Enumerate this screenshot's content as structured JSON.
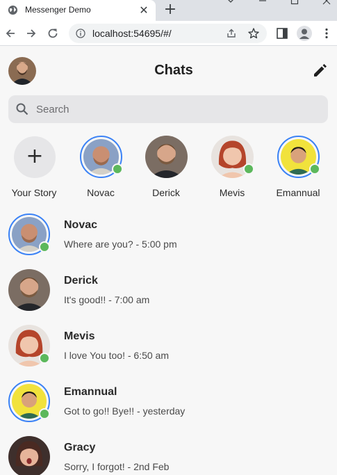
{
  "browser": {
    "tab_title": "Messenger Demo",
    "tab_close": "✕",
    "new_tab": "+",
    "url": "localhost:54695/#/"
  },
  "app": {
    "title": "Chats",
    "search_placeholder": "Search",
    "add_story_label": "+",
    "your_story_label": "Your Story"
  },
  "stories": [
    {
      "name": "Novac",
      "active": true,
      "online": true
    },
    {
      "name": "Derick",
      "active": false,
      "online": false
    },
    {
      "name": "Mevis",
      "active": false,
      "online": true
    },
    {
      "name": "Emannual",
      "active": true,
      "online": true
    }
  ],
  "chats": [
    {
      "name": "Novac",
      "message": "Where are you? - 5:00 pm",
      "active": true,
      "online": true
    },
    {
      "name": "Derick",
      "message": "It's good!! - 7:00 am",
      "active": false,
      "online": false
    },
    {
      "name": "Mevis",
      "message": "I love You too! - 6:50 am",
      "active": false,
      "online": true
    },
    {
      "name": "Emannual",
      "message": "Got to go!! Bye!! - yesterday",
      "active": true,
      "online": true
    },
    {
      "name": "Gracy",
      "message": "Sorry, I forgot! - 2nd Feb",
      "active": false,
      "online": false
    }
  ],
  "colors": {
    "accent": "#3b82f6",
    "online": "#5cb85c"
  }
}
